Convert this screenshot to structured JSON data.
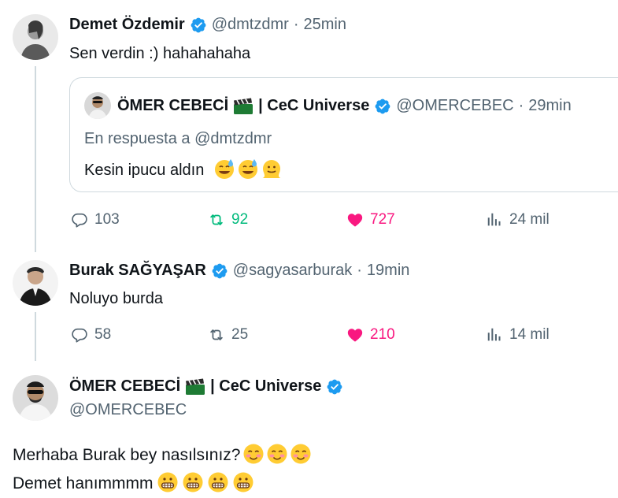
{
  "tweet1": {
    "name": "Demet Özdemir",
    "handle": "@dmtzdmr",
    "sep": "·",
    "time": "25min",
    "text": "Sen verdin :) hahahahaha",
    "quote": {
      "name": "ÖMER CEBECİ",
      "name_suffix": "| CeC Universe",
      "handle": "@OMERCEBEC",
      "sep": "·",
      "time": "29min",
      "reply_to": "En respuesta a @dmtzdmr",
      "text": "Kesin ipucu aldın",
      "emojis": [
        "sweat-smile",
        "sweat-smile",
        "melting-face"
      ]
    },
    "stats": {
      "replies": "103",
      "retweets": "92",
      "likes": "727",
      "views": "24 mil"
    }
  },
  "tweet2": {
    "name": "Burak SAĞYAŞAR",
    "handle": "@sagyasarburak",
    "sep": "·",
    "time": "19min",
    "text": "Noluyo burda",
    "stats": {
      "replies": "58",
      "retweets": "25",
      "likes": "210",
      "views": "14 mil"
    }
  },
  "tweet3": {
    "name": "ÖMER CEBECİ",
    "name_suffix": "| CeC Universe",
    "handle": "@OMERCEBEC",
    "line1": "Merhaba Burak bey nasılsınız?",
    "line1_emojis": [
      "blush",
      "blush",
      "blush"
    ],
    "line2": "Demet hanımmmm",
    "line2_emojis": [
      "grimacing",
      "grimacing",
      "grimacing",
      "grimacing"
    ]
  },
  "colors": {
    "verified": "#1d9bf0",
    "retweet": "#00ba7c",
    "like": "#f91880",
    "muted": "#536471",
    "line": "#cfd9de"
  }
}
